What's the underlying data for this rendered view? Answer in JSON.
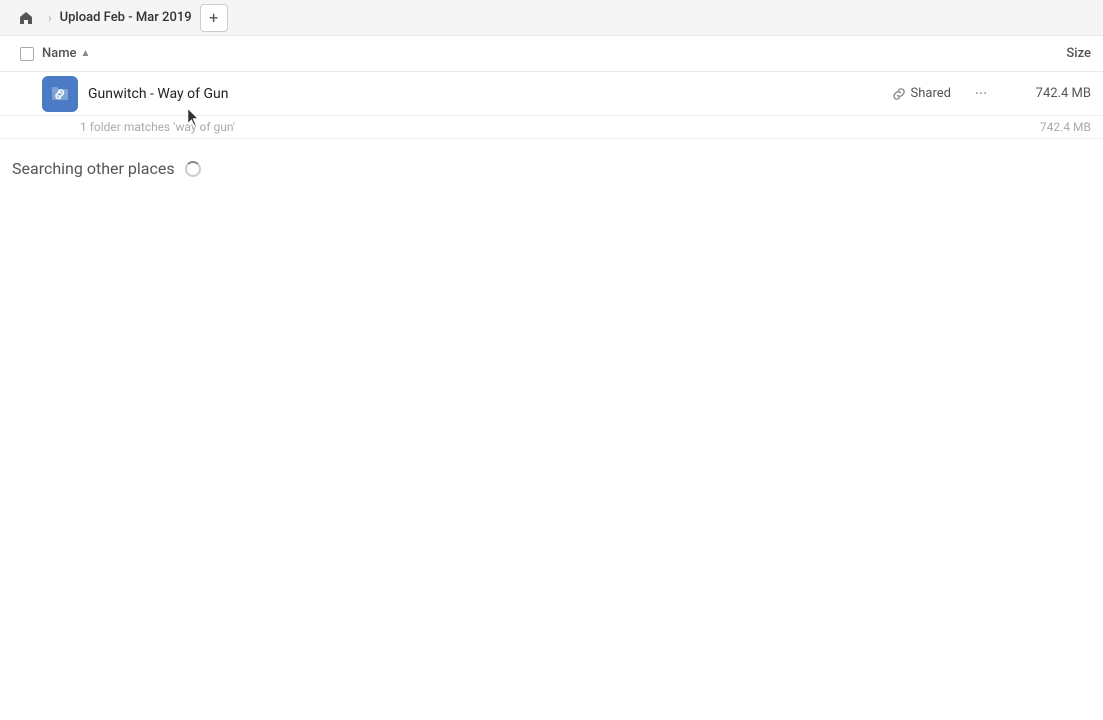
{
  "breadcrumb": {
    "home_label": "Home",
    "folder_label": "Upload Feb - Mar 2019",
    "separator": "›",
    "add_button_label": "+"
  },
  "columns": {
    "name_label": "Name",
    "sort_arrow": "▲",
    "size_label": "Size"
  },
  "file_item": {
    "name": "Gunwitch - Way of Gun",
    "shared_label": "Shared",
    "more_label": "···",
    "size": "742.4 MB"
  },
  "match_info": {
    "text": "1 folder matches 'way of gun'",
    "size": "742.4 MB"
  },
  "searching": {
    "text": "Searching other places"
  }
}
